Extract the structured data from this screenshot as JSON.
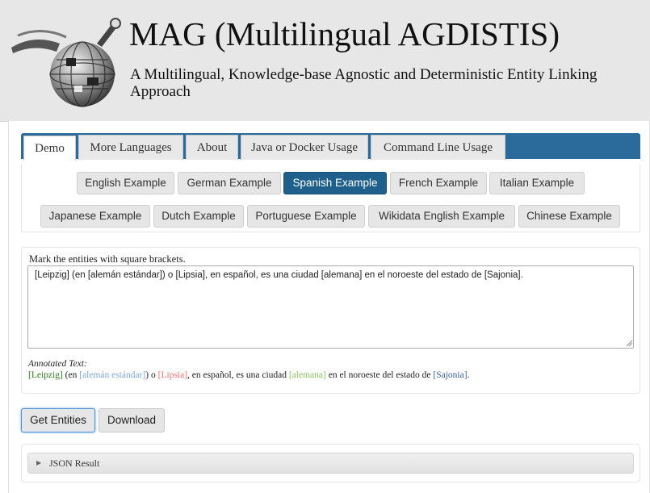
{
  "header": {
    "title": "MAG (Multilingual AGDISTIS)",
    "subtitle": "A Multilingual, Knowledge-base Agnostic and Deterministic Entity Linking Approach"
  },
  "tabs": [
    {
      "label": "Demo",
      "active": true
    },
    {
      "label": "More Languages"
    },
    {
      "label": "About"
    },
    {
      "label": "Java or Docker Usage"
    },
    {
      "label": "Command Line Usage"
    }
  ],
  "examples": [
    {
      "label": "English Example"
    },
    {
      "label": "German Example"
    },
    {
      "label": "Spanish Example",
      "active": true
    },
    {
      "label": "French Example"
    },
    {
      "label": "Italian Example"
    },
    {
      "label": "Japanese Example"
    },
    {
      "label": "Dutch Example"
    },
    {
      "label": "Portuguese Example"
    },
    {
      "label": "Wikidata English Example"
    },
    {
      "label": "Chinese Example"
    }
  ],
  "input": {
    "label": "Mark the entities with square brackets.",
    "value": "[Leipzig] (en [alemán estándar]) o [Lipsia], en español, es una ciudad [alemana] en el noroeste del estado de [Sajonia]."
  },
  "annotated": {
    "label": "Annotated Text:",
    "segments": [
      "[Leipzig]",
      " (en ",
      "[alemán estándar]",
      ") o ",
      "[Lipsia]",
      ", en español, es una ciudad ",
      "[alemana]",
      " en el noroeste del estado de ",
      "[Sajonia]",
      "."
    ]
  },
  "actions": {
    "get_entities": "Get Entities",
    "download": "Download"
  },
  "json_result": {
    "label": "JSON Result"
  },
  "colors": {
    "tabbar": "#2a6b9c",
    "active_example": "#1f5f8b",
    "entity_colors": [
      "#2e7d1f",
      "#7fa7d6",
      "#f07070",
      "#8cc265",
      "#3a5f9a"
    ]
  }
}
